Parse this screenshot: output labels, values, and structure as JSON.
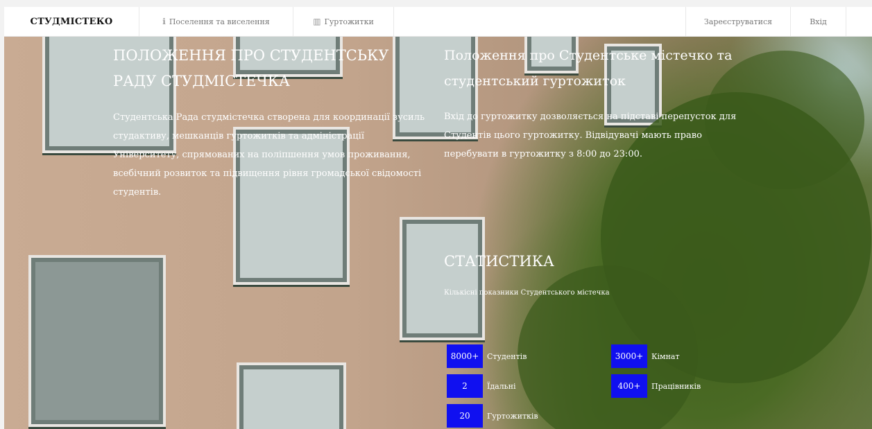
{
  "nav": {
    "brand": "СТУДМІСТЕКО",
    "items": [
      {
        "label": "Поселення та виселення",
        "icon": "info-icon"
      },
      {
        "label": "Гуртожитки",
        "icon": "building-icon"
      }
    ],
    "register": "Зареєструватися",
    "login": "Вхід"
  },
  "left": {
    "title": "ПОЛОЖЕННЯ ПРО СТУДЕНТСЬКУ РАДУ СТУДМІСТЕЧКА",
    "text": "Студентська Рада студмістечка створена для координації зусиль студактиву, мешканців гуртожитків та адміністрації Університету, спрямованих на поліпшення умов проживання, всебічний розвиток та підвищення рівня громадської свідомості студентів."
  },
  "right": {
    "title": "Положення про Студентське містечко та студентський гуртожиток",
    "text": "Вхід до гуртожитку дозволяється на підставі перепусток для Студентів цього гуртожитку. Відвідувачі мають право перебувати в гуртожитку з 8:00 до 23:00."
  },
  "stats": {
    "title": "СТАТИСТИКА",
    "subtitle": "Кількісні показники Студентського містечка",
    "items": [
      {
        "value": "8000+",
        "label": "Студентів"
      },
      {
        "value": "3000+",
        "label": "Кімнат"
      },
      {
        "value": "2",
        "label": "Їдальні"
      },
      {
        "value": "400+",
        "label": "Працівників"
      },
      {
        "value": "20",
        "label": "Гуртожитків"
      }
    ]
  },
  "colors": {
    "stat_badge": "#1010f0",
    "nav_bg": "#ffffff",
    "hero_text": "#ffffff"
  }
}
